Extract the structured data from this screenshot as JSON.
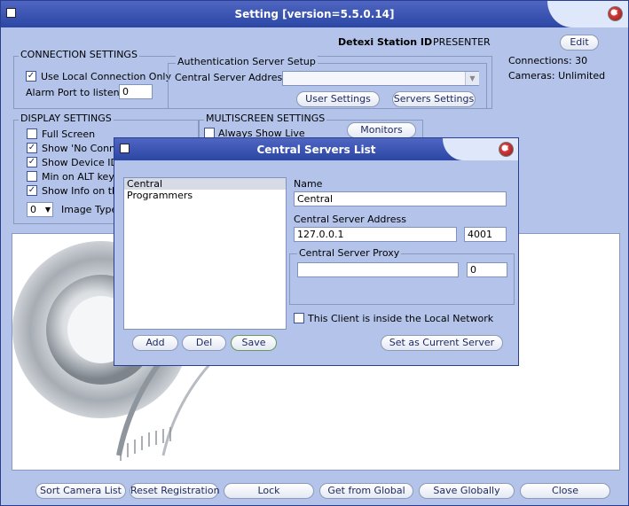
{
  "window": {
    "title": "Setting [version=5.5.0.14]"
  },
  "station": {
    "label": "Detexi Station ID",
    "value": "PRESENTER",
    "edit_label": "Edit"
  },
  "stats": {
    "connections": "Connections: 30",
    "cameras": "Cameras: Unlimited"
  },
  "connection": {
    "title": "CONNECTION SETTINGS",
    "use_local_label": "Use Local Connection Only",
    "alarm_port_label": "Alarm Port to listen",
    "alarm_port_value": "0"
  },
  "auth": {
    "title": "Authentication Server Setup",
    "central_label": "Central Server Address",
    "user_settings_label": "User Settings",
    "servers_settings_label": "Servers Settings"
  },
  "display": {
    "title": "DISPLAY SETTINGS",
    "full_screen": "Full Screen",
    "show_no_conn": "Show 'No Conne",
    "show_device_id": "Show Device ID",
    "min_alt": "Min on ALT key",
    "show_info": "Show Info on the",
    "image_type_value": "0",
    "image_type_label": "Image Type"
  },
  "multiscreen": {
    "title": "MULTISCREEN SETTINGS",
    "always_show_live": "Always Show Live",
    "monitors_label": "Monitors"
  },
  "bottom_buttons": [
    "Sort Camera List",
    "Reset Registration",
    "Lock",
    "Get from Global",
    "Save Globally",
    "Close"
  ],
  "dialog": {
    "title": "Central Servers List",
    "servers": [
      "Central",
      "Programmers"
    ],
    "name_label": "Name",
    "name_value": "Central",
    "address_label": "Central Server Address",
    "address_value": "127.0.0.1",
    "port_value": "4001",
    "proxy_label": "Central Server Proxy",
    "proxy_address_value": "",
    "proxy_port_value": "0",
    "local_network_label": "This Client is inside the Local Network",
    "add_label": "Add",
    "del_label": "Del",
    "save_label": "Save",
    "set_current_label": "Set as Current Server"
  }
}
